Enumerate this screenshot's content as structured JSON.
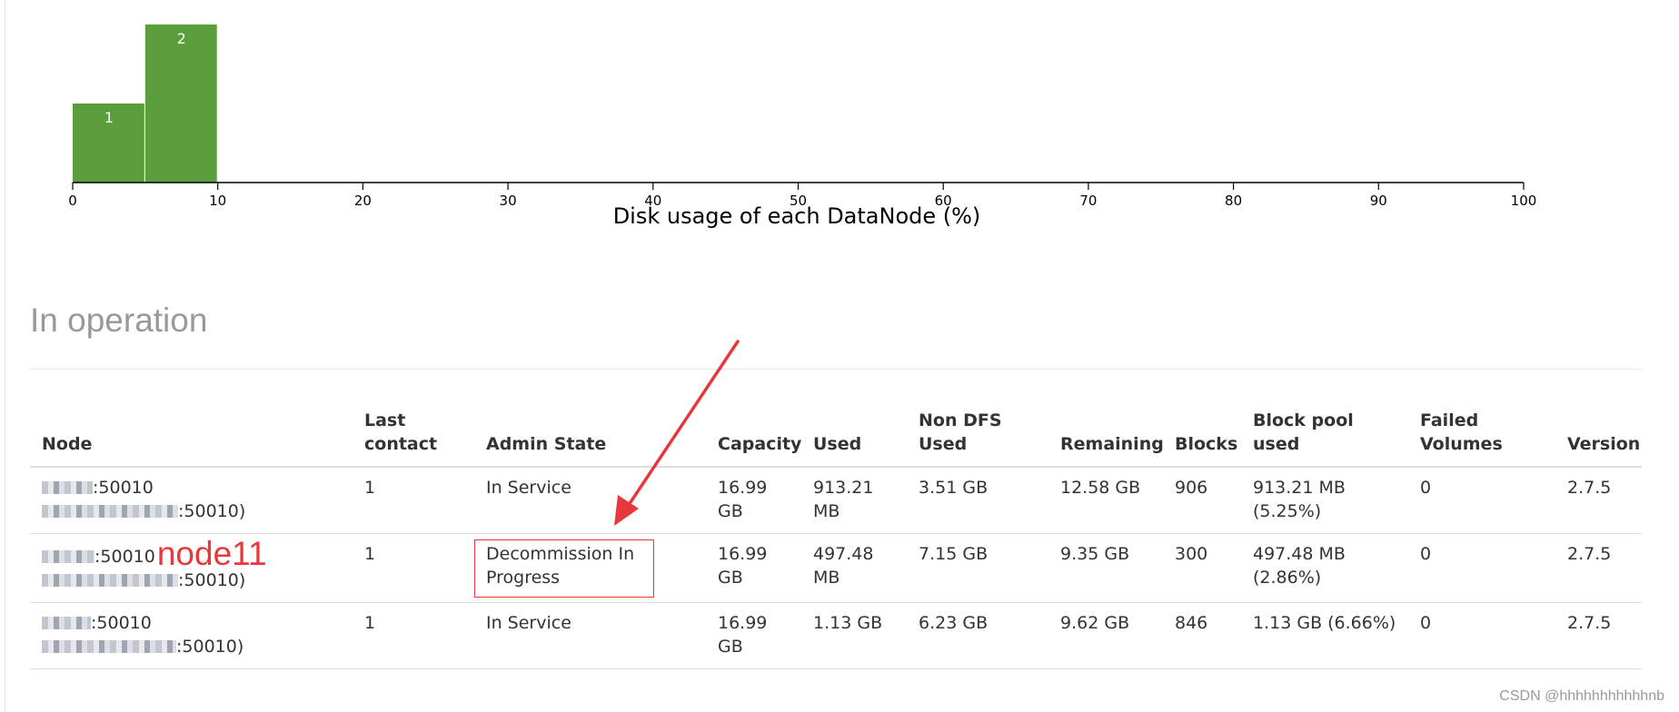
{
  "chart_data": {
    "type": "bar",
    "xlabel": "Disk usage of each DataNode (%)",
    "xlim": [
      0,
      100
    ],
    "xticks": [
      0,
      10,
      20,
      30,
      40,
      50,
      60,
      70,
      80,
      90,
      100
    ],
    "bins": [
      {
        "x0": 0,
        "x1": 5,
        "count": 1
      },
      {
        "x0": 5,
        "x1": 10,
        "count": 2
      }
    ],
    "bar_color": "#5a9e3c"
  },
  "section": {
    "title": "In operation"
  },
  "table": {
    "headers": {
      "node": "Node",
      "last_contact": "Last contact",
      "admin_state": "Admin State",
      "capacity": "Capacity",
      "used": "Used",
      "non_dfs_used": "Non DFS Used",
      "remaining": "Remaining",
      "blocks": "Blocks",
      "block_pool_used": "Block pool used",
      "failed_volumes": "Failed Volumes",
      "version": "Version"
    },
    "rows": [
      {
        "node_line1": ":50010",
        "node_line2": ":50010)",
        "last_contact": "1",
        "admin_state": "In Service",
        "capacity": "16.99 GB",
        "used": "913.21 MB",
        "non_dfs_used": "3.51 GB",
        "remaining": "12.58 GB",
        "blocks": "906",
        "block_pool_used": "913.21 MB (5.25%)",
        "failed_volumes": "0",
        "version": "2.7.5"
      },
      {
        "node_line1": ":50010",
        "node_annotation": "node11",
        "node_line2": ":50010)",
        "last_contact": "1",
        "admin_state": "Decommission In Progress",
        "capacity": "16.99 GB",
        "used": "497.48 MB",
        "non_dfs_used": "7.15 GB",
        "remaining": "9.35 GB",
        "blocks": "300",
        "block_pool_used": "497.48 MB (2.86%)",
        "failed_volumes": "0",
        "version": "2.7.5"
      },
      {
        "node_line1": ":50010",
        "node_line2": ":50010)",
        "last_contact": "1",
        "admin_state": "In Service",
        "capacity": "16.99 GB",
        "used": "1.13 GB",
        "non_dfs_used": "6.23 GB",
        "remaining": "9.62 GB",
        "blocks": "846",
        "block_pool_used": "1.13 GB (6.66%)",
        "failed_volumes": "0",
        "version": "2.7.5"
      }
    ]
  },
  "annotation_color": "#e8383d",
  "watermark": "CSDN @hhhhhhhhhhhnb"
}
